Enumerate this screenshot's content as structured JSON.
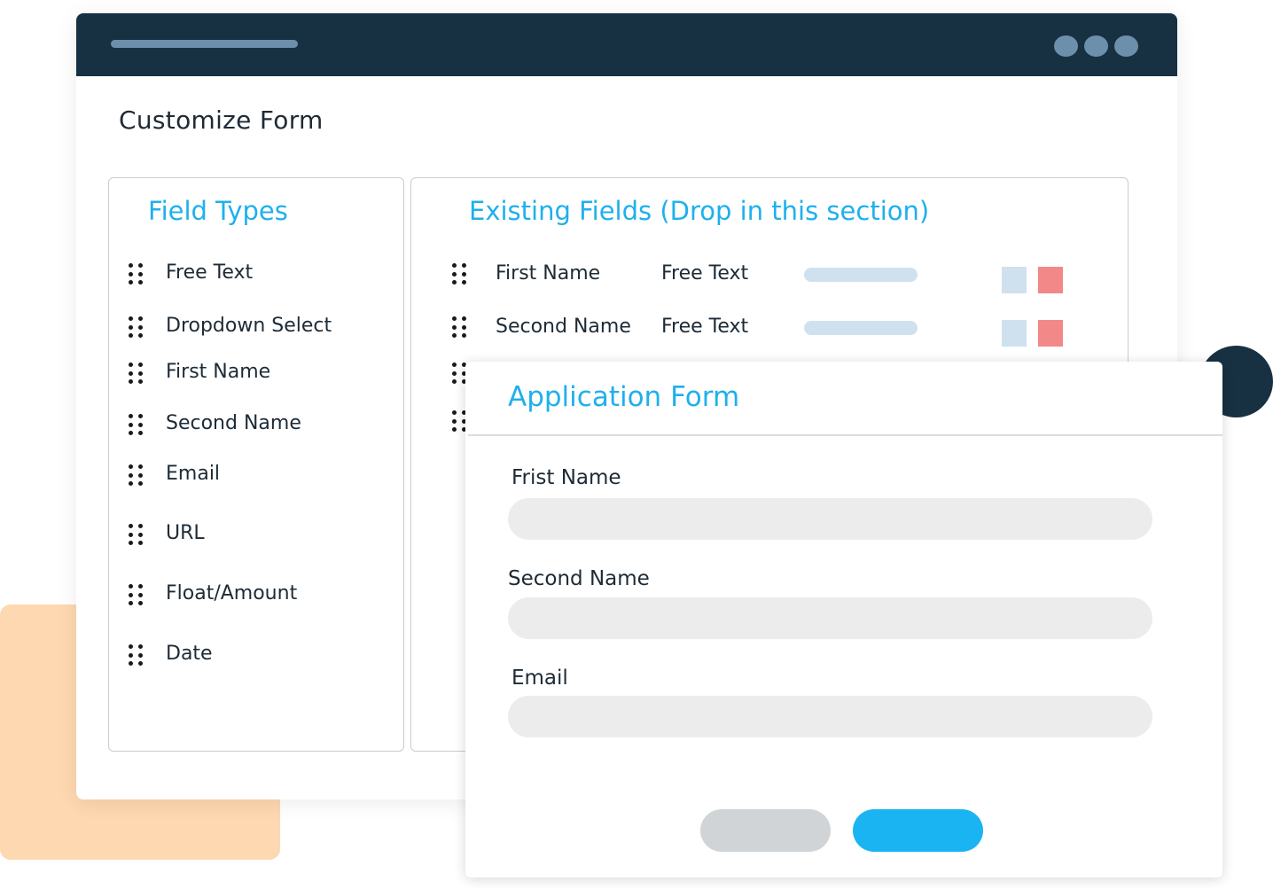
{
  "page": {
    "title": "Customize Form"
  },
  "field_types": {
    "heading": "Field Types",
    "items": [
      {
        "label": "Free Text"
      },
      {
        "label": "Dropdown Select"
      },
      {
        "label": "First Name"
      },
      {
        "label": "Second Name"
      },
      {
        "label": "Email"
      },
      {
        "label": "URL"
      },
      {
        "label": "Float/Amount"
      },
      {
        "label": "Date"
      }
    ]
  },
  "existing_fields": {
    "heading": "Existing Fields (Drop in this section)",
    "rows": [
      {
        "name": "First Name",
        "type": "Free Text"
      },
      {
        "name": "Second Name",
        "type": "Free Text"
      }
    ]
  },
  "application_form": {
    "title": "Application Form",
    "fields": [
      {
        "label": "Frist Name",
        "value": ""
      },
      {
        "label": "Second Name",
        "value": ""
      },
      {
        "label": "Email",
        "value": ""
      }
    ]
  },
  "colors": {
    "titlebar": "#173142",
    "accent": "#1fb0ec",
    "edit_button": "#cfe1ee",
    "delete_button": "#f28888",
    "submit_button": "#1ab4f2",
    "cancel_button": "#d0d4d6",
    "decor_peach": "#fdd8b0"
  },
  "icons": {
    "drag_handle": "grip-dots-icon",
    "window_controls": "more-dots-icon"
  }
}
